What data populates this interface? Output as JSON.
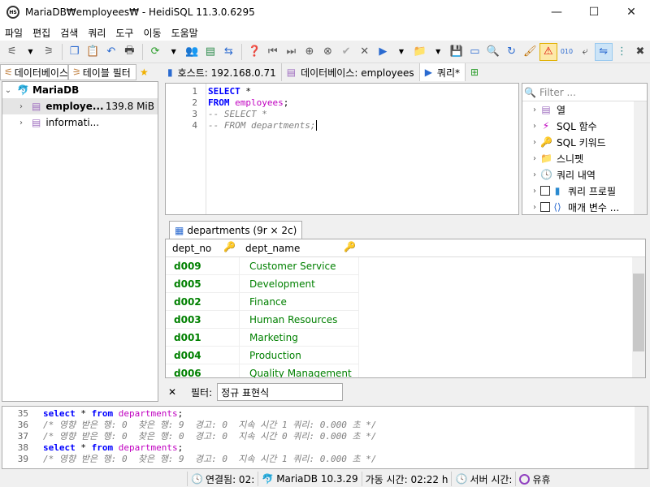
{
  "window": {
    "title": "MariaDB₩employees₩ - HeidiSQL 11.3.0.6295",
    "minimize": "—",
    "maximize": "☐",
    "close": "✕"
  },
  "menu": [
    "파일",
    "편집",
    "검색",
    "쿼리",
    "도구",
    "이동",
    "도움말"
  ],
  "left_tabs": {
    "db_tab": "데이터베이스",
    "table_filter_tab": "테이블 필터"
  },
  "tree": {
    "root": "MariaDB",
    "items": [
      {
        "name": "employees",
        "display": "employe...",
        "size": "139.8 MiB"
      },
      {
        "name": "information_schema",
        "display": "informati...",
        "size": ""
      }
    ]
  },
  "main_tabs": {
    "host": "호스트: 192.168.0.71",
    "database": "데이터베이스: employees",
    "query": "쿼리*"
  },
  "editor": {
    "lines": [
      {
        "num": "1",
        "parts": [
          {
            "t": "SELECT",
            "c": "kw"
          },
          {
            "t": " *",
            "c": ""
          }
        ]
      },
      {
        "num": "2",
        "parts": [
          {
            "t": "FROM",
            "c": "kw"
          },
          {
            "t": " ",
            "c": ""
          },
          {
            "t": "employees",
            "c": "tbl"
          },
          {
            "t": ";",
            "c": ""
          }
        ]
      },
      {
        "num": "3",
        "parts": [
          {
            "t": "-- SELECT *",
            "c": "cmt"
          }
        ]
      },
      {
        "num": "4",
        "parts": [
          {
            "t": "-- FROM departments;",
            "c": "cmt"
          }
        ]
      }
    ]
  },
  "helper": {
    "filter_placeholder": "Filter ...",
    "items": [
      "열",
      "SQL 함수",
      "SQL 키워드",
      "스니펫",
      "쿼리 내역",
      "쿼리 프로필",
      "매개 변수 ..."
    ]
  },
  "result": {
    "tab_label": "departments (9r × 2c)",
    "columns": [
      "dept_no",
      "dept_name"
    ],
    "rows": [
      [
        "d009",
        "Customer Service"
      ],
      [
        "d005",
        "Development"
      ],
      [
        "d002",
        "Finance"
      ],
      [
        "d003",
        "Human Resources"
      ],
      [
        "d001",
        "Marketing"
      ],
      [
        "d004",
        "Production"
      ],
      [
        "d006",
        "Quality Management"
      ]
    ]
  },
  "filterbar": {
    "close": "✕",
    "label": "필터:",
    "value": "정규 표현식"
  },
  "log": {
    "lines": [
      {
        "num": "35",
        "text": "select * from departments;",
        "type": "sql"
      },
      {
        "num": "36",
        "text": "/* 영향 받은 행: 0  찾은 행: 9  경고: 0  지속 시간 1 쿼리: 0.000 초 */",
        "type": "cmt"
      },
      {
        "num": "37",
        "text": "/* 영향 받은 행: 0  찾은 행: 0  경고: 0  지속 시간 0 쿼리: 0.000 초 */",
        "type": "cmt"
      },
      {
        "num": "38",
        "text": "select * from departments;",
        "type": "sql"
      },
      {
        "num": "39",
        "text": "/* 영향 받은 행: 0  찾은 행: 9  경고: 0  지속 시간 1 쿼리: 0.000 초 */",
        "type": "cmt"
      }
    ]
  },
  "status": {
    "connected": "연결됨: 02:",
    "server": "MariaDB 10.3.29",
    "uptime": "가동 시간: 02:22 h",
    "server_time": "서버 시간:",
    "idle": "유휴"
  }
}
